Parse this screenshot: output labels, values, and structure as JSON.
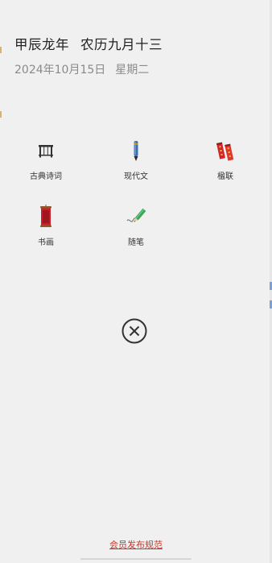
{
  "header": {
    "ganzhi_year": "甲辰龙年",
    "lunar_date": "农历九月十三",
    "gregorian_date": "2024年10月15日",
    "weekday": "星期二"
  },
  "categories": [
    {
      "label": "古典诗词",
      "icon": "guqin-icon"
    },
    {
      "label": "现代文",
      "icon": "pen-icon"
    },
    {
      "label": "楹联",
      "icon": "couplet-icon"
    },
    {
      "label": "书画",
      "icon": "scroll-icon"
    },
    {
      "label": "随笔",
      "icon": "pencil-icon"
    }
  ],
  "footer": {
    "rules_link": "会员发布规范"
  },
  "colors": {
    "accent_red": "#c0392b",
    "background": "#f0f0f0"
  }
}
